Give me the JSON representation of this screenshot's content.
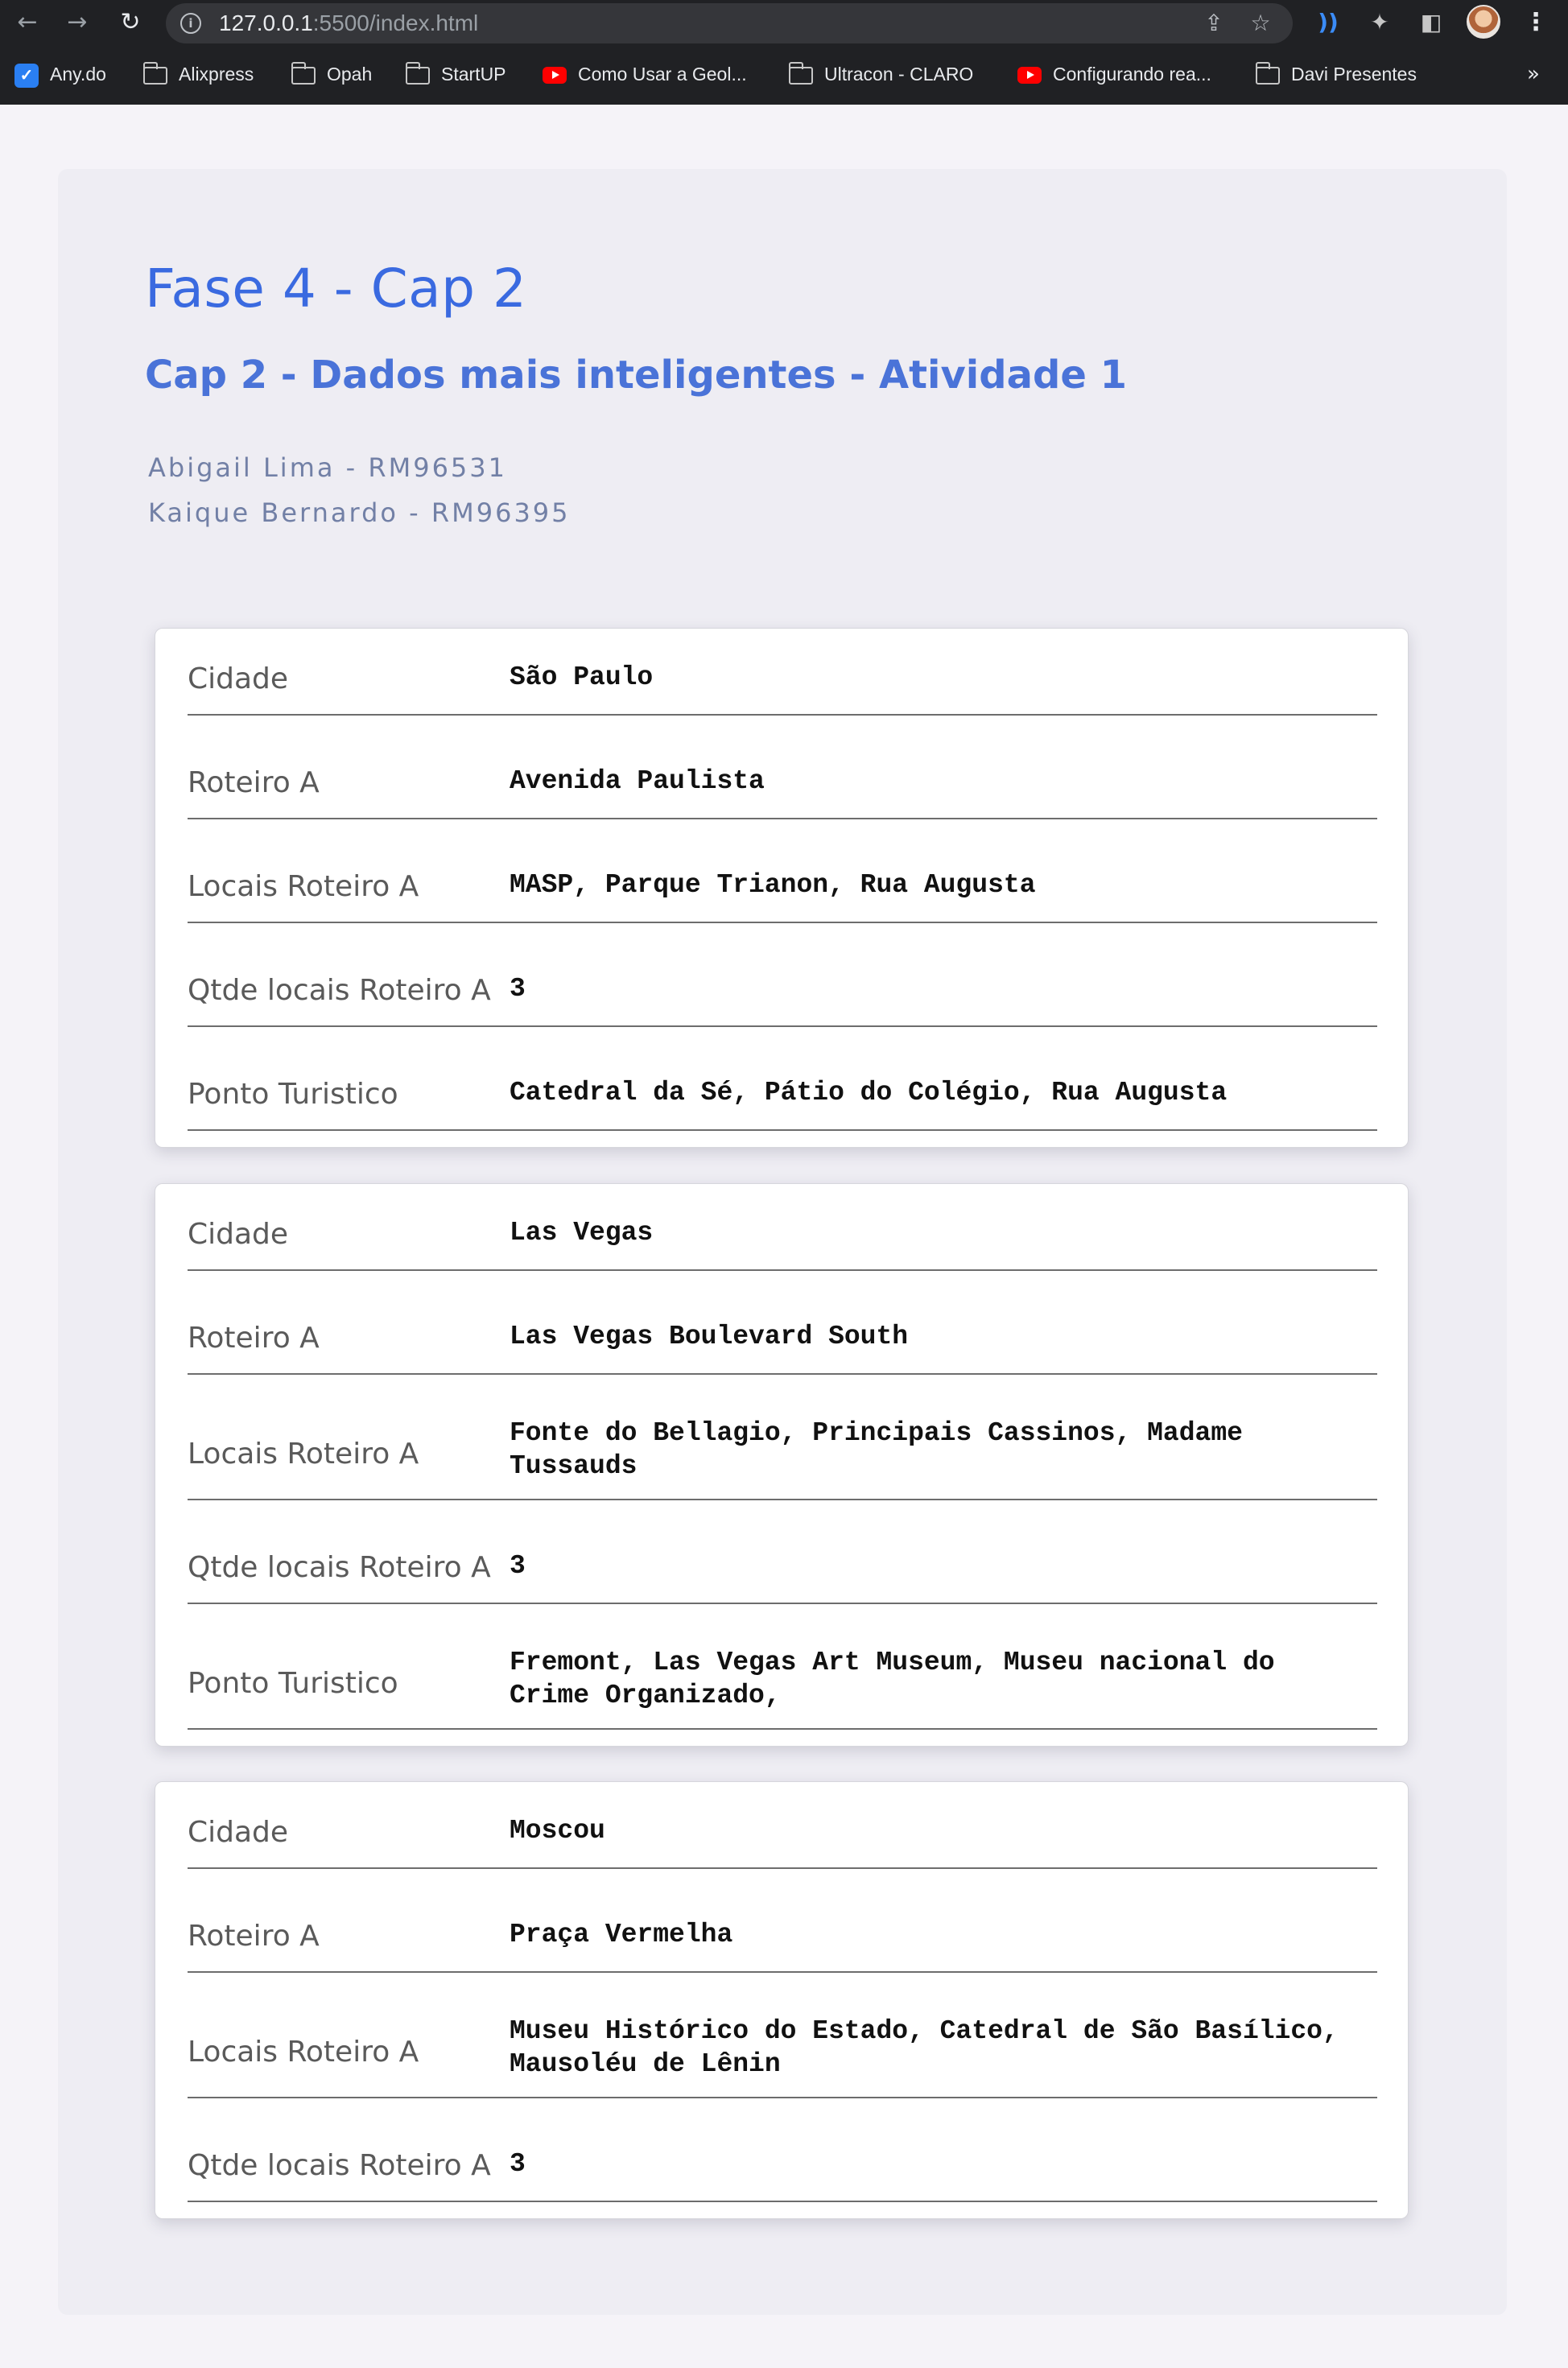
{
  "browser": {
    "url_host": "127.0.0.1",
    "url_rest": ":5500/index.html",
    "bookmarks": [
      {
        "label": "Any.do",
        "icon": "anydo-icon"
      },
      {
        "label": "Alixpress",
        "icon": "folder-icon"
      },
      {
        "label": "Opah",
        "icon": "folder-icon"
      },
      {
        "label": "StartUP",
        "icon": "folder-icon"
      },
      {
        "label": "Como Usar a Geol...",
        "icon": "youtube-icon"
      },
      {
        "label": "Ultracon - CLARO",
        "icon": "folder-icon"
      },
      {
        "label": "Configurando rea...",
        "icon": "youtube-icon"
      },
      {
        "label": "Davi Presentes",
        "icon": "folder-icon"
      }
    ],
    "more_label": "»"
  },
  "page": {
    "title": "Fase 4 - Cap 2",
    "subtitle": "Cap 2 - Dados mais inteligentes - Atividade 1",
    "authors": [
      "Abigail Lima - RM96531",
      "Kaique Bernardo - RM96395"
    ]
  },
  "cards": [
    {
      "rows": [
        {
          "label": "Cidade",
          "value": "São Paulo"
        },
        {
          "label": "Roteiro A",
          "value": "Avenida Paulista"
        },
        {
          "label": "Locais Roteiro A",
          "value": "MASP, Parque Trianon, Rua Augusta"
        },
        {
          "label": "Qtde locais Roteiro A",
          "value": "3"
        },
        {
          "label": "Ponto Turistico",
          "value": "Catedral da Sé, Pátio do Colégio, Rua Augusta"
        }
      ]
    },
    {
      "rows": [
        {
          "label": "Cidade",
          "value": "Las Vegas"
        },
        {
          "label": "Roteiro A",
          "value": "Las Vegas Boulevard South"
        },
        {
          "label": "Locais Roteiro A",
          "value": "Fonte do Bellagio, Principais Cassinos, Madame Tussauds"
        },
        {
          "label": "Qtde locais Roteiro A",
          "value": "3"
        },
        {
          "label": "Ponto Turistico",
          "value": "Fremont, Las Vegas Art Museum, Museu nacional do Crime Organizado,"
        }
      ]
    },
    {
      "rows": [
        {
          "label": "Cidade",
          "value": "Moscou"
        },
        {
          "label": "Roteiro A",
          "value": "Praça Vermelha"
        },
        {
          "label": "Locais Roteiro A",
          "value": "Museu Histórico do Estado, Catedral de São Basílico, Mausoléu de Lênin"
        },
        {
          "label": "Qtde locais Roteiro A",
          "value": "3"
        }
      ]
    }
  ]
}
